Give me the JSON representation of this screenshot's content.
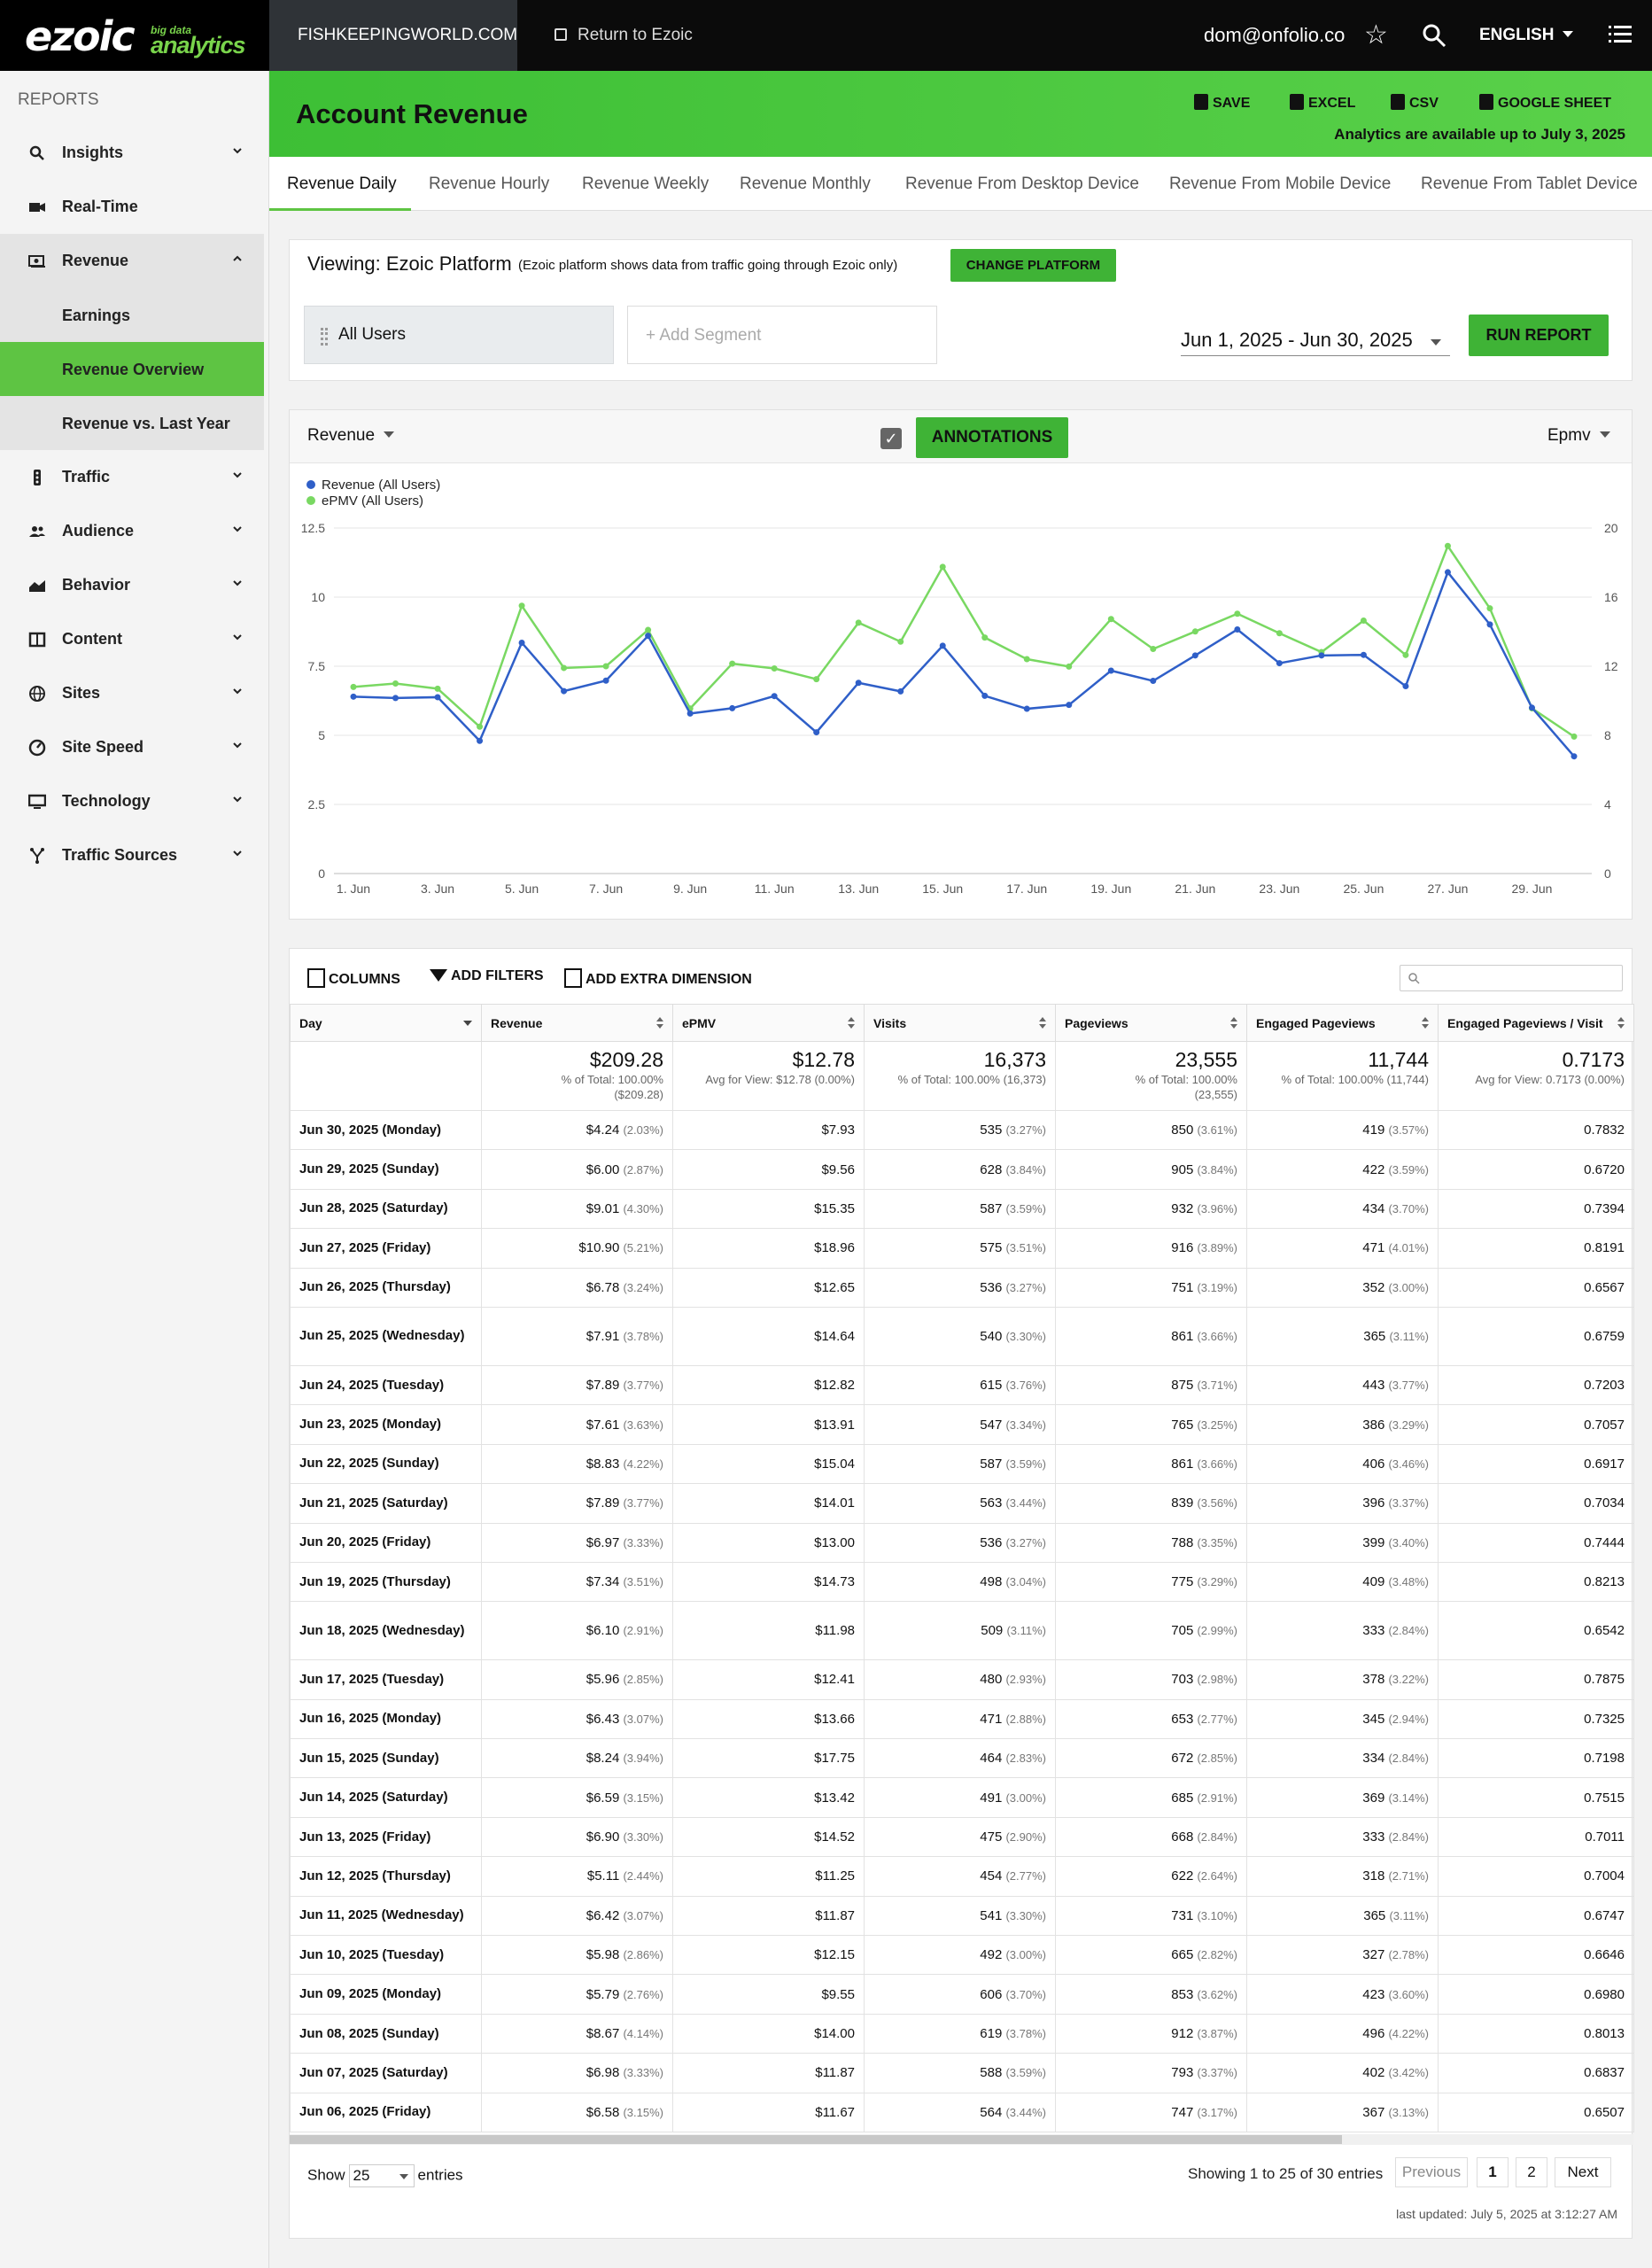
{
  "topbar": {
    "site": "FISHKEEPINGWORLD.COM",
    "return_label": "Return to Ezoic",
    "email": "dom@onfolio.co",
    "language": "ENGLISH",
    "logo_main": "ezoic",
    "logo_small": "big data",
    "logo_sub": "analytics"
  },
  "sidebar": {
    "heading": "REPORTS",
    "items": [
      {
        "label": "Insights",
        "icon": "search-icon"
      },
      {
        "label": "Real-Time",
        "icon": "camera-icon"
      },
      {
        "label": "Revenue",
        "icon": "money-icon"
      },
      {
        "label": "Traffic",
        "icon": "traffic-light-icon"
      },
      {
        "label": "Audience",
        "icon": "people-icon"
      },
      {
        "label": "Behavior",
        "icon": "chart-icon"
      },
      {
        "label": "Content",
        "icon": "book-icon"
      },
      {
        "label": "Sites",
        "icon": "globe-icon"
      },
      {
        "label": "Site Speed",
        "icon": "speedometer-icon"
      },
      {
        "label": "Technology",
        "icon": "monitor-icon"
      },
      {
        "label": "Traffic Sources",
        "icon": "fork-icon"
      }
    ],
    "sub_items": [
      {
        "label": "Earnings"
      },
      {
        "label": "Revenue Overview"
      },
      {
        "label": "Revenue vs. Last Year"
      }
    ]
  },
  "header": {
    "title": "Account Revenue",
    "save": "SAVE",
    "excel": "EXCEL",
    "csv": "CSV",
    "google_sheet": "GOOGLE SHEET",
    "availability": "Analytics are available up to July 3, 2025"
  },
  "tabs": [
    "Revenue Daily",
    "Revenue Hourly",
    "Revenue Weekly",
    "Revenue Monthly",
    "Revenue From Desktop Device",
    "Revenue From Mobile Device",
    "Revenue From Tablet Device"
  ],
  "viewing": {
    "label": "Viewing: Ezoic Platform",
    "note": "(Ezoic platform shows data from traffic going through Ezoic only)",
    "change_button": "CHANGE PLATFORM",
    "segment": "All Users",
    "add_segment": "+ Add Segment",
    "date_range": "Jun 1, 2025 - Jun 30, 2025",
    "run_button": "RUN REPORT"
  },
  "chart_controls": {
    "metric": "Revenue",
    "annotations": "ANNOTATIONS",
    "metric2": "Epmv"
  },
  "chart_data": {
    "type": "line",
    "x": [
      "1. Jun",
      "2. Jun",
      "3. Jun",
      "4. Jun",
      "5. Jun",
      "6. Jun",
      "7. Jun",
      "8. Jun",
      "9. Jun",
      "10. Jun",
      "11. Jun",
      "12. Jun",
      "13. Jun",
      "14. Jun",
      "15. Jun",
      "16. Jun",
      "17. Jun",
      "18. Jun",
      "19. Jun",
      "20. Jun",
      "21. Jun",
      "22. Jun",
      "23. Jun",
      "24. Jun",
      "25. Jun",
      "26. Jun",
      "27. Jun",
      "28. Jun",
      "29. Jun",
      "30. Jun"
    ],
    "x_tick_labels": [
      "1. Jun",
      "3. Jun",
      "5. Jun",
      "7. Jun",
      "9. Jun",
      "11. Jun",
      "13. Jun",
      "15. Jun",
      "17. Jun",
      "19. Jun",
      "21. Jun",
      "23. Jun",
      "25. Jun",
      "27. Jun",
      "29. Jun"
    ],
    "series": [
      {
        "name": "Revenue (All Users)",
        "axis": "left",
        "color": "#2f5fc8",
        "values": [
          6.4,
          6.35,
          6.38,
          4.8,
          8.35,
          6.6,
          6.98,
          8.6,
          5.79,
          5.98,
          6.42,
          5.11,
          6.9,
          6.59,
          8.24,
          6.43,
          5.96,
          6.1,
          7.34,
          6.97,
          7.89,
          8.83,
          7.61,
          7.89,
          7.91,
          6.78,
          10.9,
          9.01,
          6.0,
          4.24
        ]
      },
      {
        "name": "ePMV (All Users)",
        "axis": "right",
        "color": "#79d862",
        "values": [
          10.8,
          11.0,
          10.7,
          8.5,
          15.5,
          11.9,
          12.0,
          14.1,
          9.55,
          12.15,
          11.87,
          11.25,
          14.52,
          13.42,
          17.75,
          13.66,
          12.41,
          11.98,
          14.73,
          13.0,
          14.01,
          15.04,
          13.91,
          12.82,
          14.64,
          12.65,
          18.96,
          15.35,
          9.56,
          7.93
        ]
      }
    ],
    "y_left": {
      "min": 0,
      "max": 12.5,
      "ticks": [
        "0",
        "2.5",
        "5",
        "7.5",
        "10",
        "12.5"
      ]
    },
    "y_right": {
      "min": 0,
      "max": 20,
      "ticks": [
        "0",
        "4",
        "8",
        "12",
        "16",
        "20"
      ]
    },
    "legend_placement": "top-left",
    "grid": true
  },
  "table_tools": {
    "columns": "COLUMNS",
    "filters": "ADD FILTERS",
    "extra_dimension": "ADD EXTRA DIMENSION"
  },
  "table": {
    "headers": [
      "Day",
      "Revenue",
      "ePMV",
      "Visits",
      "Pageviews",
      "Engaged Pageviews",
      "Engaged Pageviews / Visit"
    ],
    "totals": {
      "revenue": "$209.28",
      "revenue_sub1": "% of Total: 100.00%",
      "revenue_sub2": "($209.28)",
      "epmv": "$12.78",
      "epmv_sub": "Avg for View: $12.78 (0.00%)",
      "visits": "16,373",
      "visits_sub": "% of Total: 100.00% (16,373)",
      "pageviews": "23,555",
      "pageviews_sub1": "% of Total: 100.00%",
      "pageviews_sub2": "(23,555)",
      "engaged": "11,744",
      "engaged_sub": "% of Total: 100.00% (11,744)",
      "epv": "0.7173",
      "epv_sub": "Avg for View: 0.7173 (0.00%)"
    },
    "rows": [
      {
        "day": "Jun 30, 2025 (Monday)",
        "rev": "$4.24",
        "rev_pct": "(2.03%)",
        "epmv": "$7.93",
        "visits": "535",
        "visits_pct": "(3.27%)",
        "pv": "850",
        "pv_pct": "(3.61%)",
        "eng": "419",
        "eng_pct": "(3.57%)",
        "epv": "0.7832"
      },
      {
        "day": "Jun 29, 2025 (Sunday)",
        "rev": "$6.00",
        "rev_pct": "(2.87%)",
        "epmv": "$9.56",
        "visits": "628",
        "visits_pct": "(3.84%)",
        "pv": "905",
        "pv_pct": "(3.84%)",
        "eng": "422",
        "eng_pct": "(3.59%)",
        "epv": "0.6720"
      },
      {
        "day": "Jun 28, 2025 (Saturday)",
        "rev": "$9.01",
        "rev_pct": "(4.30%)",
        "epmv": "$15.35",
        "visits": "587",
        "visits_pct": "(3.59%)",
        "pv": "932",
        "pv_pct": "(3.96%)",
        "eng": "434",
        "eng_pct": "(3.70%)",
        "epv": "0.7394"
      },
      {
        "day": "Jun 27, 2025 (Friday)",
        "rev": "$10.90",
        "rev_pct": "(5.21%)",
        "epmv": "$18.96",
        "visits": "575",
        "visits_pct": "(3.51%)",
        "pv": "916",
        "pv_pct": "(3.89%)",
        "eng": "471",
        "eng_pct": "(4.01%)",
        "epv": "0.8191"
      },
      {
        "day": "Jun 26, 2025 (Thursday)",
        "rev": "$6.78",
        "rev_pct": "(3.24%)",
        "epmv": "$12.65",
        "visits": "536",
        "visits_pct": "(3.27%)",
        "pv": "751",
        "pv_pct": "(3.19%)",
        "eng": "352",
        "eng_pct": "(3.00%)",
        "epv": "0.6567"
      },
      {
        "day": "Jun 25, 2025 (Wednesday)",
        "rev": "$7.91",
        "rev_pct": "(3.78%)",
        "epmv": "$14.64",
        "visits": "540",
        "visits_pct": "(3.30%)",
        "pv": "861",
        "pv_pct": "(3.66%)",
        "eng": "365",
        "eng_pct": "(3.11%)",
        "epv": "0.6759",
        "tall": true
      },
      {
        "day": "Jun 24, 2025 (Tuesday)",
        "rev": "$7.89",
        "rev_pct": "(3.77%)",
        "epmv": "$12.82",
        "visits": "615",
        "visits_pct": "(3.76%)",
        "pv": "875",
        "pv_pct": "(3.71%)",
        "eng": "443",
        "eng_pct": "(3.77%)",
        "epv": "0.7203"
      },
      {
        "day": "Jun 23, 2025 (Monday)",
        "rev": "$7.61",
        "rev_pct": "(3.63%)",
        "epmv": "$13.91",
        "visits": "547",
        "visits_pct": "(3.34%)",
        "pv": "765",
        "pv_pct": "(3.25%)",
        "eng": "386",
        "eng_pct": "(3.29%)",
        "epv": "0.7057"
      },
      {
        "day": "Jun 22, 2025 (Sunday)",
        "rev": "$8.83",
        "rev_pct": "(4.22%)",
        "epmv": "$15.04",
        "visits": "587",
        "visits_pct": "(3.59%)",
        "pv": "861",
        "pv_pct": "(3.66%)",
        "eng": "406",
        "eng_pct": "(3.46%)",
        "epv": "0.6917"
      },
      {
        "day": "Jun 21, 2025 (Saturday)",
        "rev": "$7.89",
        "rev_pct": "(3.77%)",
        "epmv": "$14.01",
        "visits": "563",
        "visits_pct": "(3.44%)",
        "pv": "839",
        "pv_pct": "(3.56%)",
        "eng": "396",
        "eng_pct": "(3.37%)",
        "epv": "0.7034"
      },
      {
        "day": "Jun 20, 2025 (Friday)",
        "rev": "$6.97",
        "rev_pct": "(3.33%)",
        "epmv": "$13.00",
        "visits": "536",
        "visits_pct": "(3.27%)",
        "pv": "788",
        "pv_pct": "(3.35%)",
        "eng": "399",
        "eng_pct": "(3.40%)",
        "epv": "0.7444"
      },
      {
        "day": "Jun 19, 2025 (Thursday)",
        "rev": "$7.34",
        "rev_pct": "(3.51%)",
        "epmv": "$14.73",
        "visits": "498",
        "visits_pct": "(3.04%)",
        "pv": "775",
        "pv_pct": "(3.29%)",
        "eng": "409",
        "eng_pct": "(3.48%)",
        "epv": "0.8213"
      },
      {
        "day": "Jun 18, 2025 (Wednesday)",
        "rev": "$6.10",
        "rev_pct": "(2.91%)",
        "epmv": "$11.98",
        "visits": "509",
        "visits_pct": "(3.11%)",
        "pv": "705",
        "pv_pct": "(2.99%)",
        "eng": "333",
        "eng_pct": "(2.84%)",
        "epv": "0.6542",
        "tall": true
      },
      {
        "day": "Jun 17, 2025 (Tuesday)",
        "rev": "$5.96",
        "rev_pct": "(2.85%)",
        "epmv": "$12.41",
        "visits": "480",
        "visits_pct": "(2.93%)",
        "pv": "703",
        "pv_pct": "(2.98%)",
        "eng": "378",
        "eng_pct": "(3.22%)",
        "epv": "0.7875"
      },
      {
        "day": "Jun 16, 2025 (Monday)",
        "rev": "$6.43",
        "rev_pct": "(3.07%)",
        "epmv": "$13.66",
        "visits": "471",
        "visits_pct": "(2.88%)",
        "pv": "653",
        "pv_pct": "(2.77%)",
        "eng": "345",
        "eng_pct": "(2.94%)",
        "epv": "0.7325"
      },
      {
        "day": "Jun 15, 2025 (Sunday)",
        "rev": "$8.24",
        "rev_pct": "(3.94%)",
        "epmv": "$17.75",
        "visits": "464",
        "visits_pct": "(2.83%)",
        "pv": "672",
        "pv_pct": "(2.85%)",
        "eng": "334",
        "eng_pct": "(2.84%)",
        "epv": "0.7198"
      },
      {
        "day": "Jun 14, 2025 (Saturday)",
        "rev": "$6.59",
        "rev_pct": "(3.15%)",
        "epmv": "$13.42",
        "visits": "491",
        "visits_pct": "(3.00%)",
        "pv": "685",
        "pv_pct": "(2.91%)",
        "eng": "369",
        "eng_pct": "(3.14%)",
        "epv": "0.7515"
      },
      {
        "day": "Jun 13, 2025 (Friday)",
        "rev": "$6.90",
        "rev_pct": "(3.30%)",
        "epmv": "$14.52",
        "visits": "475",
        "visits_pct": "(2.90%)",
        "pv": "668",
        "pv_pct": "(2.84%)",
        "eng": "333",
        "eng_pct": "(2.84%)",
        "epv": "0.7011"
      },
      {
        "day": "Jun 12, 2025 (Thursday)",
        "rev": "$5.11",
        "rev_pct": "(2.44%)",
        "epmv": "$11.25",
        "visits": "454",
        "visits_pct": "(2.77%)",
        "pv": "622",
        "pv_pct": "(2.64%)",
        "eng": "318",
        "eng_pct": "(2.71%)",
        "epv": "0.7004"
      },
      {
        "day": "Jun 11, 2025 (Wednesday)",
        "rev": "$6.42",
        "rev_pct": "(3.07%)",
        "epmv": "$11.87",
        "visits": "541",
        "visits_pct": "(3.30%)",
        "pv": "731",
        "pv_pct": "(3.10%)",
        "eng": "365",
        "eng_pct": "(3.11%)",
        "epv": "0.6747"
      },
      {
        "day": "Jun 10, 2025 (Tuesday)",
        "rev": "$5.98",
        "rev_pct": "(2.86%)",
        "epmv": "$12.15",
        "visits": "492",
        "visits_pct": "(3.00%)",
        "pv": "665",
        "pv_pct": "(2.82%)",
        "eng": "327",
        "eng_pct": "(2.78%)",
        "epv": "0.6646"
      },
      {
        "day": "Jun 09, 2025 (Monday)",
        "rev": "$5.79",
        "rev_pct": "(2.76%)",
        "epmv": "$9.55",
        "visits": "606",
        "visits_pct": "(3.70%)",
        "pv": "853",
        "pv_pct": "(3.62%)",
        "eng": "423",
        "eng_pct": "(3.60%)",
        "epv": "0.6980"
      },
      {
        "day": "Jun 08, 2025 (Sunday)",
        "rev": "$8.67",
        "rev_pct": "(4.14%)",
        "epmv": "$14.00",
        "visits": "619",
        "visits_pct": "(3.78%)",
        "pv": "912",
        "pv_pct": "(3.87%)",
        "eng": "496",
        "eng_pct": "(4.22%)",
        "epv": "0.8013"
      },
      {
        "day": "Jun 07, 2025 (Saturday)",
        "rev": "$6.98",
        "rev_pct": "(3.33%)",
        "epmv": "$11.87",
        "visits": "588",
        "visits_pct": "(3.59%)",
        "pv": "793",
        "pv_pct": "(3.37%)",
        "eng": "402",
        "eng_pct": "(3.42%)",
        "epv": "0.6837"
      },
      {
        "day": "Jun 06, 2025 (Friday)",
        "rev": "$6.58",
        "rev_pct": "(3.15%)",
        "epmv": "$11.67",
        "visits": "564",
        "visits_pct": "(3.44%)",
        "pv": "747",
        "pv_pct": "(3.17%)",
        "eng": "367",
        "eng_pct": "(3.13%)",
        "epv": "0.6507"
      }
    ]
  },
  "footer": {
    "show": "Show",
    "page_size": "25",
    "entries": "entries",
    "showing": "Showing 1 to 25 of 30 entries",
    "previous": "Previous",
    "page1": "1",
    "page2": "2",
    "next": "Next",
    "last_updated": "last updated: July 5, 2025 at 3:12:27 AM"
  },
  "colors": {
    "accent": "#5ec443",
    "button": "#3fb336",
    "revenue_line": "#2f5fc8",
    "epmv_line": "#79d862"
  }
}
